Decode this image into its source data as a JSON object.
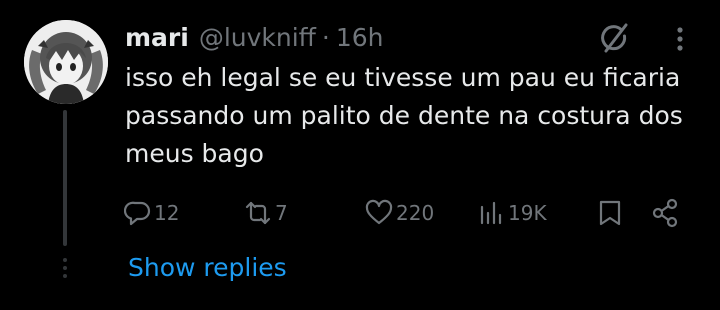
{
  "post": {
    "author": {
      "display_name": "mari",
      "handle": "@luvkniff",
      "avatar_icon": "anime-girl-avatar"
    },
    "separator": "·",
    "time": "16h",
    "text": "isso eh legal se eu tivesse um pau eu ficaria passando um palito de dente na costura dos meus bago",
    "actions": {
      "replies": "12",
      "reposts": "7",
      "likes": "220",
      "views": "19K"
    },
    "header_icons": [
      "grok-icon",
      "more-vertical-icon"
    ],
    "action_icons": [
      "reply-icon",
      "repost-icon",
      "like-icon",
      "views-icon",
      "bookmark-icon",
      "share-icon"
    ]
  },
  "thread": {
    "show_replies_label": "Show replies"
  },
  "colors": {
    "background": "#000000",
    "primary_text": "#e7e9ea",
    "secondary_text": "#71767b",
    "link": "#1d9bf0",
    "thread_line": "#333639"
  }
}
